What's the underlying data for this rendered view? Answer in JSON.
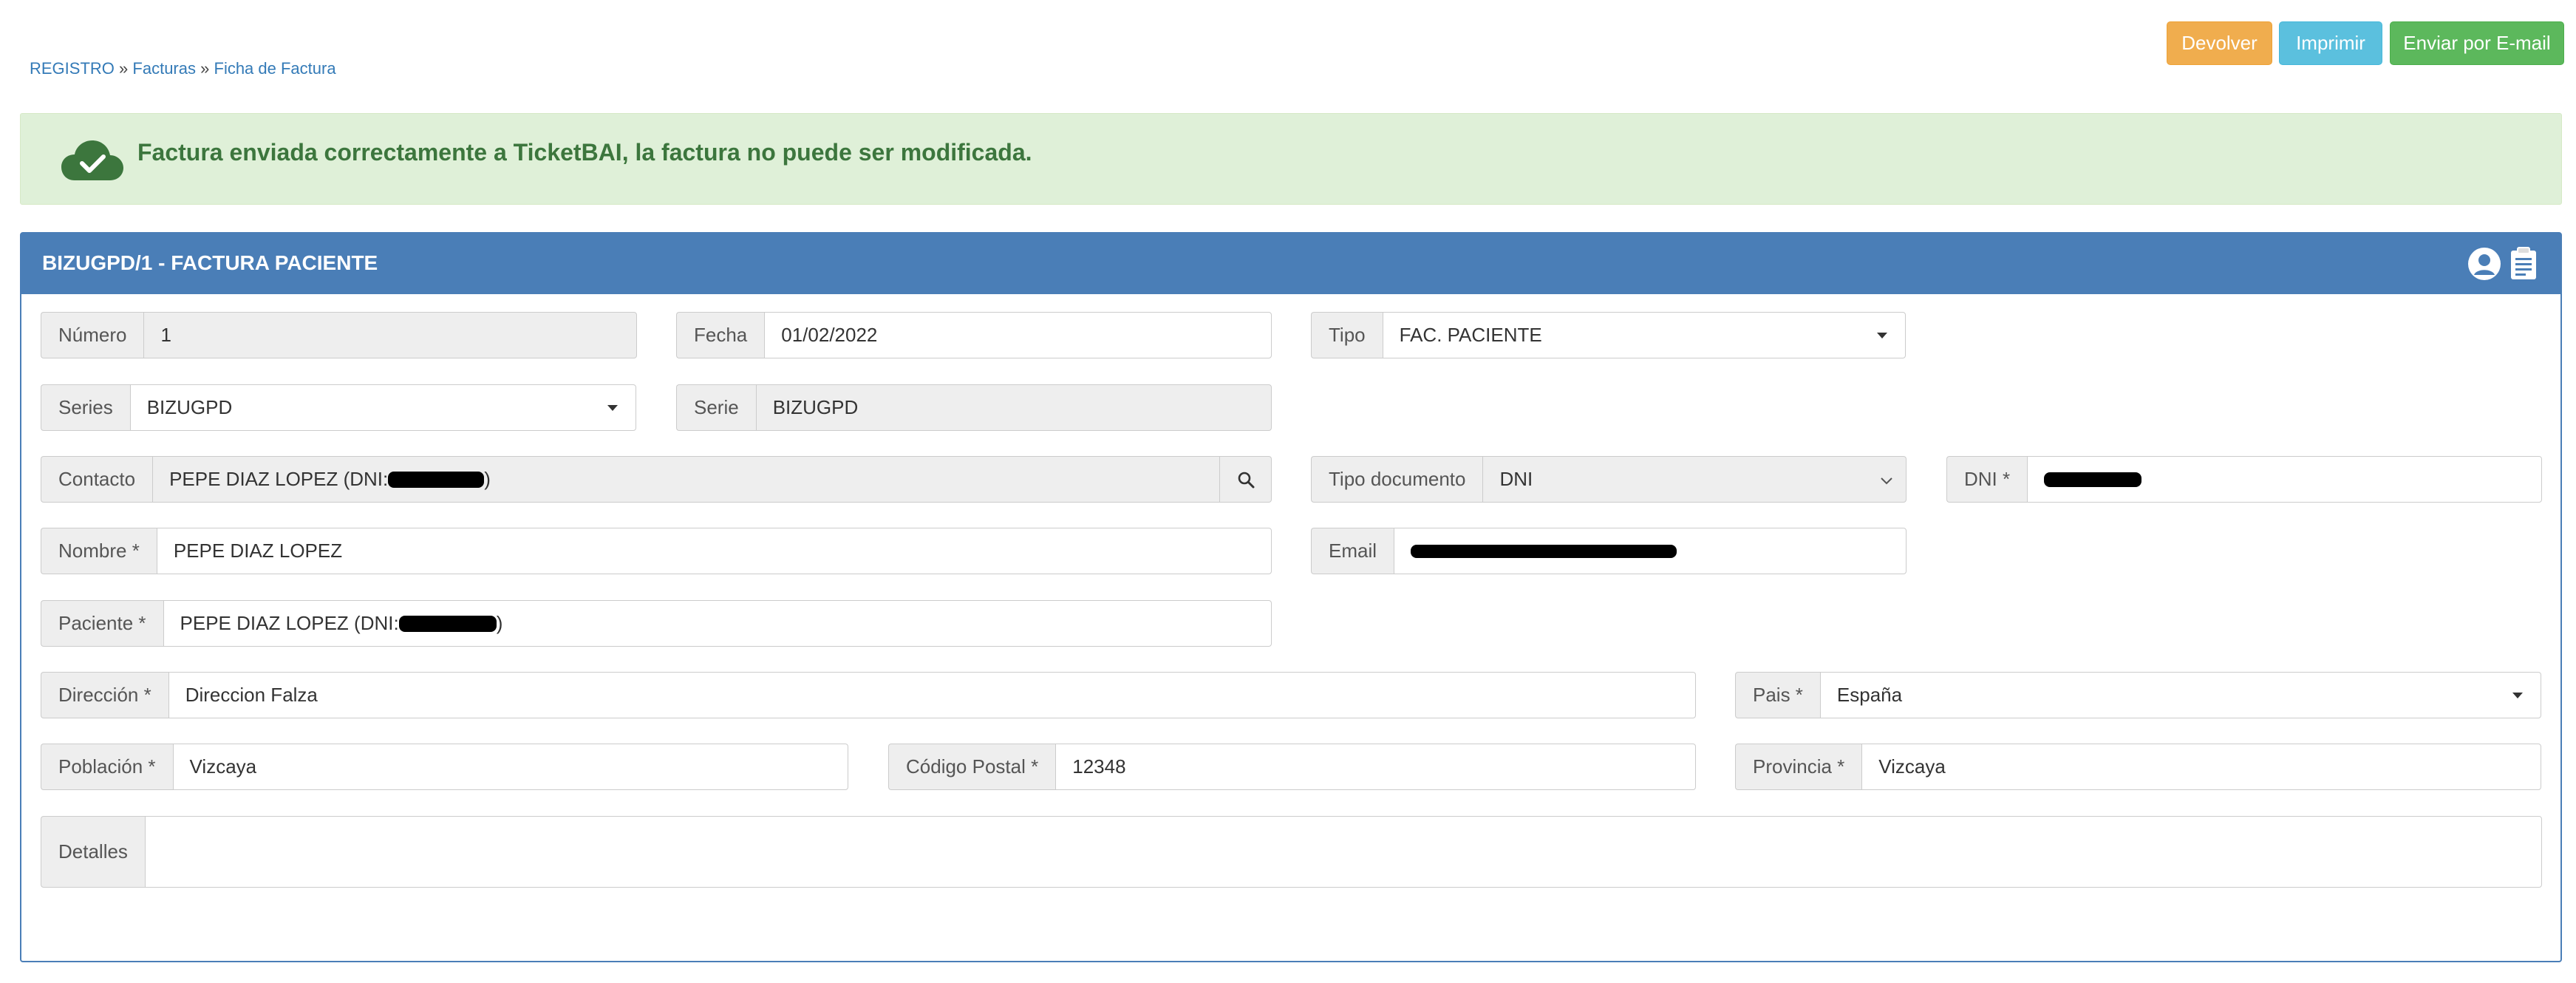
{
  "toolbar": {
    "devolver": "Devolver",
    "imprimir": "Imprimir",
    "email": "Enviar por E-mail"
  },
  "breadcrumb": {
    "root": "REGISTRO",
    "sep": "»",
    "facturas": "Facturas",
    "ficha": "Ficha de Factura"
  },
  "alert": {
    "message": "Factura enviada correctamente a TicketBAI, la factura no puede ser modificada."
  },
  "panel": {
    "title": "BIZUGPD/1 - FACTURA PACIENTE"
  },
  "form": {
    "numero": {
      "label": "Número",
      "value": "1"
    },
    "fecha": {
      "label": "Fecha",
      "value": "01/02/2022"
    },
    "tipo": {
      "label": "Tipo",
      "value": "FAC. PACIENTE"
    },
    "series": {
      "label": "Series",
      "value": "BIZUGPD"
    },
    "serie": {
      "label": "Serie",
      "value": "BIZUGPD"
    },
    "contacto": {
      "label": "Contacto",
      "value_prefix": "PEPE DIAZ LOPEZ (DNI: ",
      "value_suffix": ")"
    },
    "tipo_documento": {
      "label": "Tipo documento",
      "value": "DNI"
    },
    "dni": {
      "label": "DNI *"
    },
    "nombre": {
      "label": "Nombre *",
      "value": "PEPE DIAZ LOPEZ"
    },
    "email": {
      "label": "Email"
    },
    "paciente": {
      "label": "Paciente *",
      "value_prefix": "PEPE DIAZ LOPEZ (DNI: ",
      "value_suffix": ")"
    },
    "direccion": {
      "label": "Dirección *",
      "value": "Direccion Falza"
    },
    "pais": {
      "label": "Pais *",
      "value": "España"
    },
    "poblacion": {
      "label": "Población *",
      "value": "Vizcaya"
    },
    "codigo_postal": {
      "label": "Código Postal *",
      "value": "12348"
    },
    "provincia": {
      "label": "Provincia *",
      "value": "Vizcaya"
    },
    "detalles": {
      "label": "Detalles",
      "value": ""
    }
  },
  "colors": {
    "primary": "#4a7eb7",
    "success_bg": "#dff0d8",
    "success_text": "#3c763d",
    "warning": "#f0ad4e",
    "info": "#5bc0de",
    "success": "#5cb85c"
  },
  "icons": [
    "cloud-check-icon",
    "user-avatar-icon",
    "clipboard-icon",
    "search-icon",
    "caret-down-icon",
    "chevron-down-icon"
  ]
}
